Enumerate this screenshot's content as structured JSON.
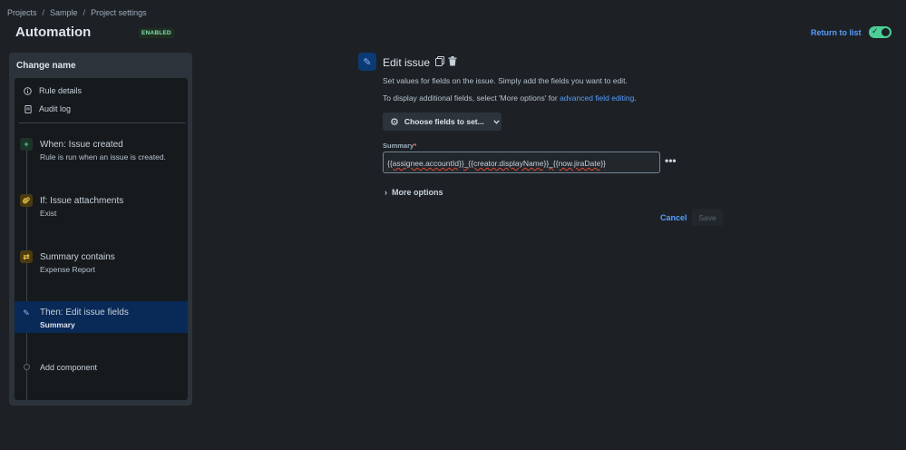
{
  "breadcrumb": [
    "Projects",
    "Sample",
    "Project settings"
  ],
  "page_title": "Automation",
  "status_badge": "ENABLED",
  "return_link": "Return to list",
  "sidebar": {
    "title": "Change name",
    "meta_items": [
      {
        "label": "Rule details",
        "icon": "info-icon"
      },
      {
        "label": "Audit log",
        "icon": "document-icon"
      }
    ],
    "steps": [
      {
        "title": "When: Issue created",
        "subtitle": "Rule is run when an issue is created.",
        "icon": "plus-icon"
      },
      {
        "title": "If: Issue attachments",
        "subtitle": "Exist",
        "icon": "paperclip-icon"
      },
      {
        "title": "Summary contains",
        "subtitle": "Expense Report",
        "icon": "shuffle-icon"
      },
      {
        "title": "Then: Edit issue fields",
        "subtitle": "Summary",
        "icon": "pencil-icon"
      }
    ],
    "add_component": "Add component"
  },
  "editor": {
    "title": "Edit issue",
    "desc1": "Set values for fields on the issue. Simply add the fields you want to edit.",
    "desc2_prefix": "To display additional fields, select 'More options' for ",
    "desc2_link": "advanced field editing",
    "desc2_suffix": ".",
    "choose_fields": "Choose fields to set...",
    "field_label": "Summary",
    "field_required": "*",
    "field_value": "{{assignee.accountId}}_{{creator.displayName}}_{{now.jiraDate}}",
    "more_options": "More options",
    "cancel": "Cancel",
    "save": "Save"
  },
  "colors": {
    "accent": "#579dff",
    "enabled": "#4bce97",
    "background": "#1d2125"
  }
}
